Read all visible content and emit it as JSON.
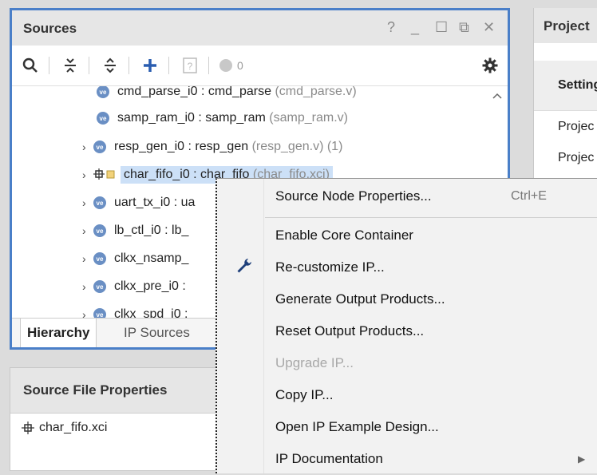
{
  "sources": {
    "title": "Sources",
    "controls": {
      "help": "?",
      "minimize": "_",
      "maximize": "☐",
      "float": "⧉",
      "close": "✕"
    },
    "toolbar": {
      "badge_count": "0"
    },
    "tree": [
      {
        "name": "cmd_parse_i0 : cmd_parse",
        "file": "(cmd_parse.v)",
        "expand": false,
        "icon": "ve"
      },
      {
        "name": "samp_ram_i0 : samp_ram",
        "file": "(samp_ram.v)",
        "expand": false,
        "icon": "ve"
      },
      {
        "name": "resp_gen_i0 : resp_gen",
        "file": "(resp_gen.v) (1)",
        "expand": true,
        "icon": "ve"
      },
      {
        "name": "char_fifo_i0 : char_fifo",
        "file": "(char_fifo.xci)",
        "expand": true,
        "icon": "ip",
        "selected": true
      },
      {
        "name": "uart_tx_i0 : ua",
        "file": "",
        "expand": true,
        "icon": "ve"
      },
      {
        "name": "lb_ctl_i0 : lb_",
        "file": "",
        "expand": true,
        "icon": "ve"
      },
      {
        "name": "clkx_nsamp_",
        "file": "",
        "expand": true,
        "icon": "ve"
      },
      {
        "name": "clkx_pre_i0 :",
        "file": "",
        "expand": true,
        "icon": "ve"
      },
      {
        "name": "clkx_spd_i0 :",
        "file": "",
        "expand": true,
        "icon": "ve"
      }
    ],
    "tabs": [
      "Hierarchy",
      "IP Sources"
    ]
  },
  "source_file_properties": {
    "title": "Source File Properties",
    "file": "char_fifo.xci"
  },
  "project": {
    "title": "Project",
    "section": "Setting",
    "rows": [
      "Projec",
      "Projec"
    ]
  },
  "context_menu": {
    "items": [
      {
        "label": "Source Node Properties...",
        "shortcut": "Ctrl+E"
      },
      {
        "label": "Enable Core Container"
      },
      {
        "label": "Re-customize IP...",
        "icon": "wrench-icon"
      },
      {
        "label": "Generate Output Products..."
      },
      {
        "label": "Reset Output Products..."
      },
      {
        "label": "Upgrade IP...",
        "disabled": true
      },
      {
        "label": "Copy IP..."
      },
      {
        "label": "Open IP Example Design..."
      },
      {
        "label": "IP Documentation",
        "submenu": true
      }
    ]
  },
  "colors": {
    "accent": "#4a7fc8",
    "selection": "#cce0f7"
  }
}
